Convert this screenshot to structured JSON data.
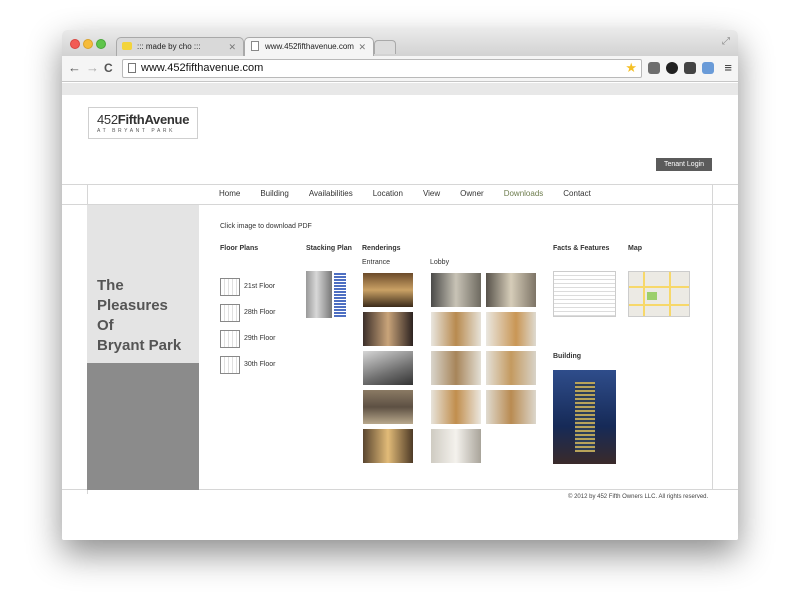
{
  "browser": {
    "tabs": [
      {
        "label": "::: made by cho :::"
      },
      {
        "label": "www.452fifthavenue.com"
      }
    ],
    "address": "www.452fifthavenue.com"
  },
  "site": {
    "logo_main_light": "452",
    "logo_main_bold": "FifthAvenue",
    "logo_sub": "AT BRYANT PARK",
    "tenant_login": "Tenant Login",
    "nav": [
      "Home",
      "Building",
      "Availabilities",
      "Location",
      "View",
      "Owner",
      "Downloads",
      "Contact"
    ],
    "nav_active": "Downloads",
    "nav_active_color": "#6f7e4f",
    "tagline": [
      "The",
      "Pleasures",
      "Of",
      "Bryant Park"
    ],
    "intro": "Click image to download PDF",
    "sections": {
      "floor_plans": "Floor Plans",
      "stacking_plan": "Stacking Plan",
      "renderings": "Renderings",
      "entrance": "Entrance",
      "lobby": "Lobby",
      "facts": "Facts & Features",
      "map": "Map",
      "building": "Building"
    },
    "floors": [
      "21st Floor",
      "28th Floor",
      "29th Floor",
      "30th Floor"
    ],
    "footer": "© 2012 by 452 Fifth Owners LLC. All rights reserved."
  }
}
